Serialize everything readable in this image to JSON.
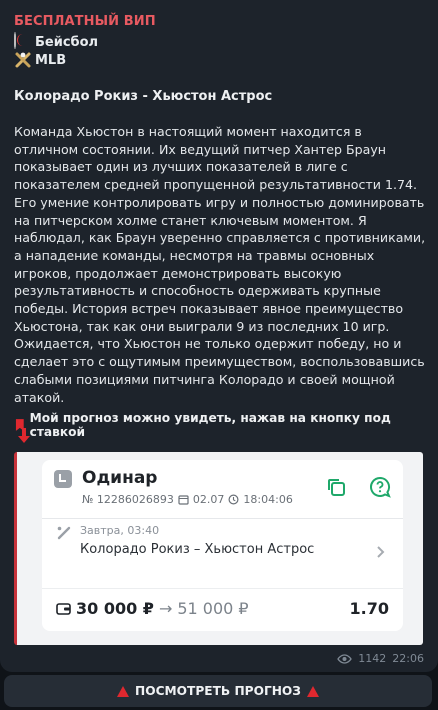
{
  "post": {
    "channel_label": "БЕСПЛАТНЫЙ ВИП",
    "sport": "Бейсбол",
    "league": "MLB",
    "match_title": "Колорадо Рокиз - Хьюстон Астрос",
    "body": "Команда Хьюстон в настоящий момент находится в отличном состоянии. Их ведущий питчер Хантер Браун показывает один из лучших показателей в лиге с показателем средней пропущенной результативности 1.74. Его умение контролировать игру и полностью доминировать на питчерском холме станет ключевым моментом. Я наблюдал, как Браун уверенно справляется с противниками, а нападение команды, несмотря на травмы основных игроков, продолжает демонстрировать высокую результативность и способность одерживать крупные победы. История встреч показывает явное преимущество Хьюстона, так как они выиграли 9 из последних 10 игр. Ожидается, что Хьюстон не только одержит победу, но и сделает это с ощутимым преимуществом, воспользовавшись слабыми позициями питчинга Колорадо и своей мощной атакой.",
    "cta_text": "Мой прогноз можно увидеть, нажав на кнопку под ставкой",
    "views": "1142",
    "time": "22:06"
  },
  "bet_card": {
    "type": "Одинар",
    "number": "№ 12286026893",
    "date": "02.07",
    "time": "18:04:06",
    "event_time": "Завтра, 03:40",
    "event_name": "Колорадо Рокиз – Хьюстон Астрос",
    "stake": "30 000 ₽",
    "payout": "51 000 ₽",
    "odds": "1.70"
  },
  "button": {
    "label": "ПОСМОТРЕТЬ ПРОГНОЗ"
  },
  "icons": {
    "sport": "baseball-icon",
    "league": "baseball-bat-icon",
    "pin": "red-bookmark-icon",
    "down": "red-down-arrow-icon",
    "views": "eye-icon",
    "alert": "red-triangle-icon"
  },
  "colors": {
    "background": "#0f1318",
    "bubble": "#1d232b",
    "channel_label": "#e85a61",
    "accent_green": "#1fa86a",
    "card_border": "#c7323a",
    "alert_red": "#e0282f"
  }
}
